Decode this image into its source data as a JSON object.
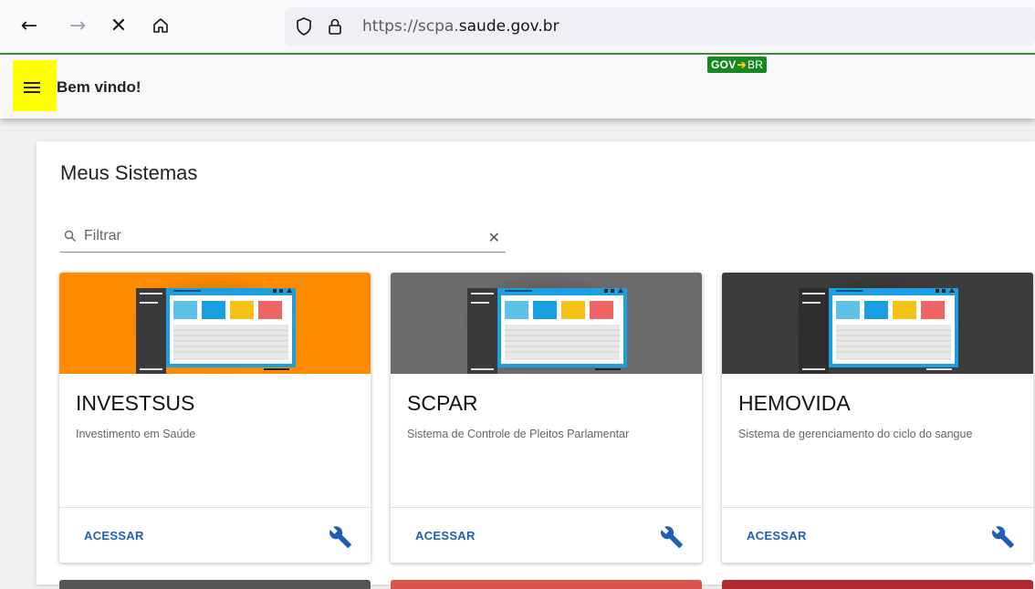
{
  "browser": {
    "url_prefix": "https://scpa.",
    "url_host": "saude.gov.br"
  },
  "header": {
    "welcome": "Bem vindo!",
    "logo": "GOV BR"
  },
  "main": {
    "title": "Meus Sistemas",
    "filter": {
      "placeholder": "Filtrar",
      "value": ""
    }
  },
  "cards": [
    {
      "title": "INVESTSUS",
      "description": "Investimento em Saúde",
      "action": "ACESSAR",
      "banner_color": "#ff8c00"
    },
    {
      "title": "SCPAR",
      "description": "Sistema de Controle de Pleitos Parlamentar",
      "action": "ACESSAR",
      "banner_color": "#6b6b6b"
    },
    {
      "title": "HEMOVIDA",
      "description": "Sistema de gerenciamento do ciclo do sangue",
      "action": "ACESSAR",
      "banner_color": "#3c3c3c"
    }
  ],
  "next_row_colors": [
    "#555555",
    "#d9534f",
    "#b02a30"
  ],
  "colors": {
    "accent": "#1e5fb3",
    "gov_green": "#168821",
    "header_border": "#3e8e35",
    "highlight": "#ffff00"
  }
}
